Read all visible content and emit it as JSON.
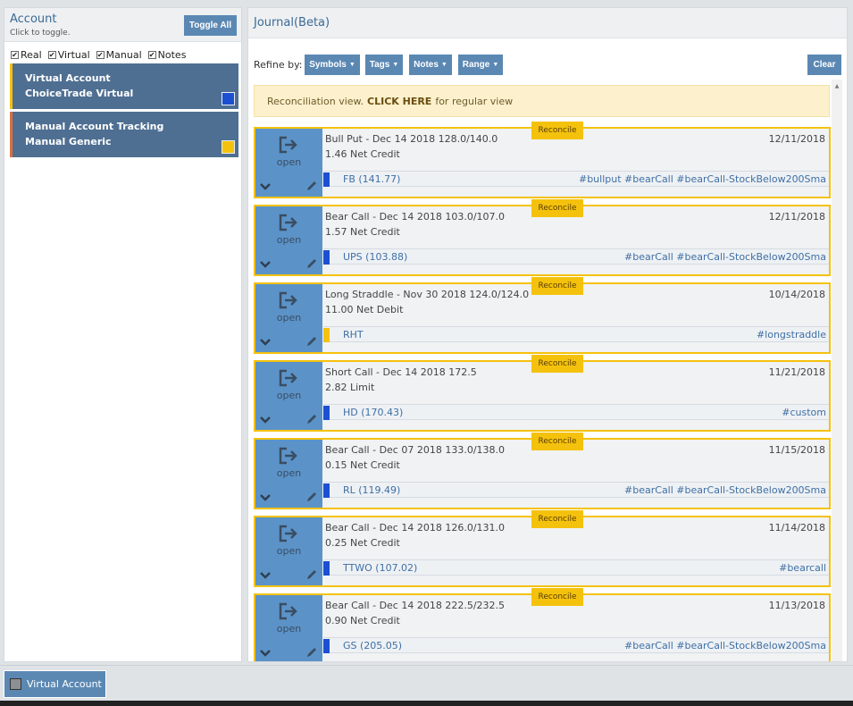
{
  "account_panel": {
    "title": "Account",
    "subtitle": "Click to toggle.",
    "toggle_all_label": "Toggle All",
    "filters": [
      {
        "label": "Real",
        "checked": true
      },
      {
        "label": "Virtual",
        "checked": true
      },
      {
        "label": "Manual",
        "checked": true
      },
      {
        "label": "Notes",
        "checked": true
      }
    ],
    "accounts": [
      {
        "name": "Virtual Account",
        "type": "ChoiceTrade Virtual",
        "bar_color": "#f4c20d",
        "swatch_color": "#1d4fd1"
      },
      {
        "name": "Manual Account Tracking",
        "type": "Manual Generic",
        "bar_color": "#d9713c",
        "swatch_color": "#f4c20d"
      }
    ]
  },
  "journal": {
    "title": "Journal(Beta)",
    "refine_label": "Refine by:",
    "filters": [
      {
        "label": "Symbols"
      },
      {
        "label": "Tags"
      },
      {
        "label": "Notes"
      },
      {
        "label": "Range"
      }
    ],
    "clear_label": "Clear",
    "banner": {
      "text": "Reconciliation view.",
      "link": "CLICK HERE",
      "suffix": "for regular view"
    },
    "reconcile_label": "Reconcile",
    "open_label": "open",
    "entries": [
      {
        "title": "Bull Put - Dec 14 2018 128.0/140.0",
        "subtitle": "1.46 Net Credit",
        "date": "12/11/2018",
        "symbol": "FB (141.77)",
        "tags": "#bullput #bearCall #bearCall-StockBelow200Sma",
        "bar_color": "#1d4fd1"
      },
      {
        "title": "Bear Call - Dec 14 2018 103.0/107.0",
        "subtitle": "1.57 Net Credit",
        "date": "12/11/2018",
        "symbol": "UPS (103.88)",
        "tags": "#bearCall #bearCall-StockBelow200Sma",
        "bar_color": "#1d4fd1"
      },
      {
        "title": "Long Straddle - Nov 30 2018 124.0/124.0",
        "subtitle": "11.00 Net Debit",
        "date": "10/14/2018",
        "symbol": "RHT",
        "tags": "#longstraddle",
        "bar_color": "#f4c20d"
      },
      {
        "title": "Short Call - Dec 14 2018 172.5",
        "subtitle": "2.82 Limit",
        "date": "11/21/2018",
        "symbol": "HD (170.43)",
        "tags": "#custom",
        "bar_color": "#1d4fd1"
      },
      {
        "title": "Bear Call - Dec 07 2018 133.0/138.0",
        "subtitle": "0.15 Net Credit",
        "date": "11/15/2018",
        "symbol": "RL (119.49)",
        "tags": "#bearCall #bearCall-StockBelow200Sma",
        "bar_color": "#1d4fd1"
      },
      {
        "title": "Bear Call - Dec 14 2018 126.0/131.0",
        "subtitle": "0.25 Net Credit",
        "date": "11/14/2018",
        "symbol": "TTWO (107.02)",
        "tags": "#bearcall",
        "bar_color": "#1d4fd1"
      },
      {
        "title": "Bear Call - Dec 14 2018 222.5/232.5",
        "subtitle": "0.90 Net Credit",
        "date": "11/13/2018",
        "symbol": "GS (205.05)",
        "tags": "#bearCall #bearCall-StockBelow200Sma",
        "bar_color": "#1d4fd1"
      }
    ]
  },
  "footer": {
    "tab_label": "Virtual Account"
  }
}
